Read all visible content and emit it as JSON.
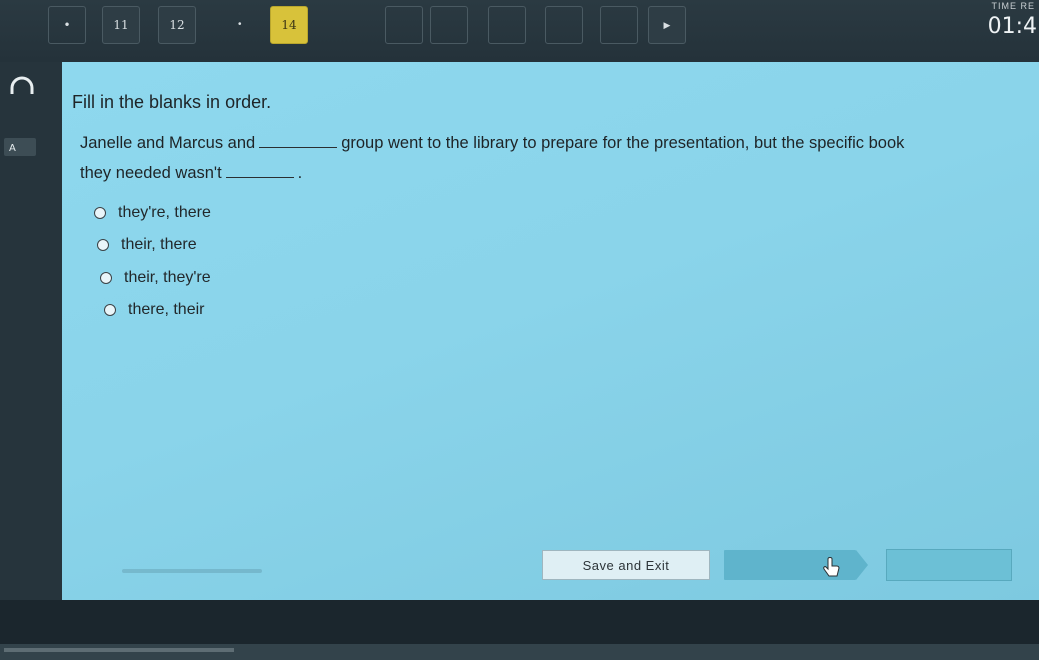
{
  "nav": {
    "questions": [
      "11",
      "12",
      "14"
    ],
    "timer_label": "TIME RE",
    "timer": "01:4"
  },
  "question": {
    "instruction": "Fill in the blanks in order.",
    "text_part1": "Janelle and Marcus and",
    "text_part2": "group went to the library to prepare for the presentation, but the specific book",
    "text_part3": "they needed wasn't",
    "text_part4": "."
  },
  "options": [
    {
      "label": "they're, there"
    },
    {
      "label": "their, there"
    },
    {
      "label": "their, they're"
    },
    {
      "label": "there, their"
    }
  ],
  "footer": {
    "save_label": "Save and Exit"
  }
}
